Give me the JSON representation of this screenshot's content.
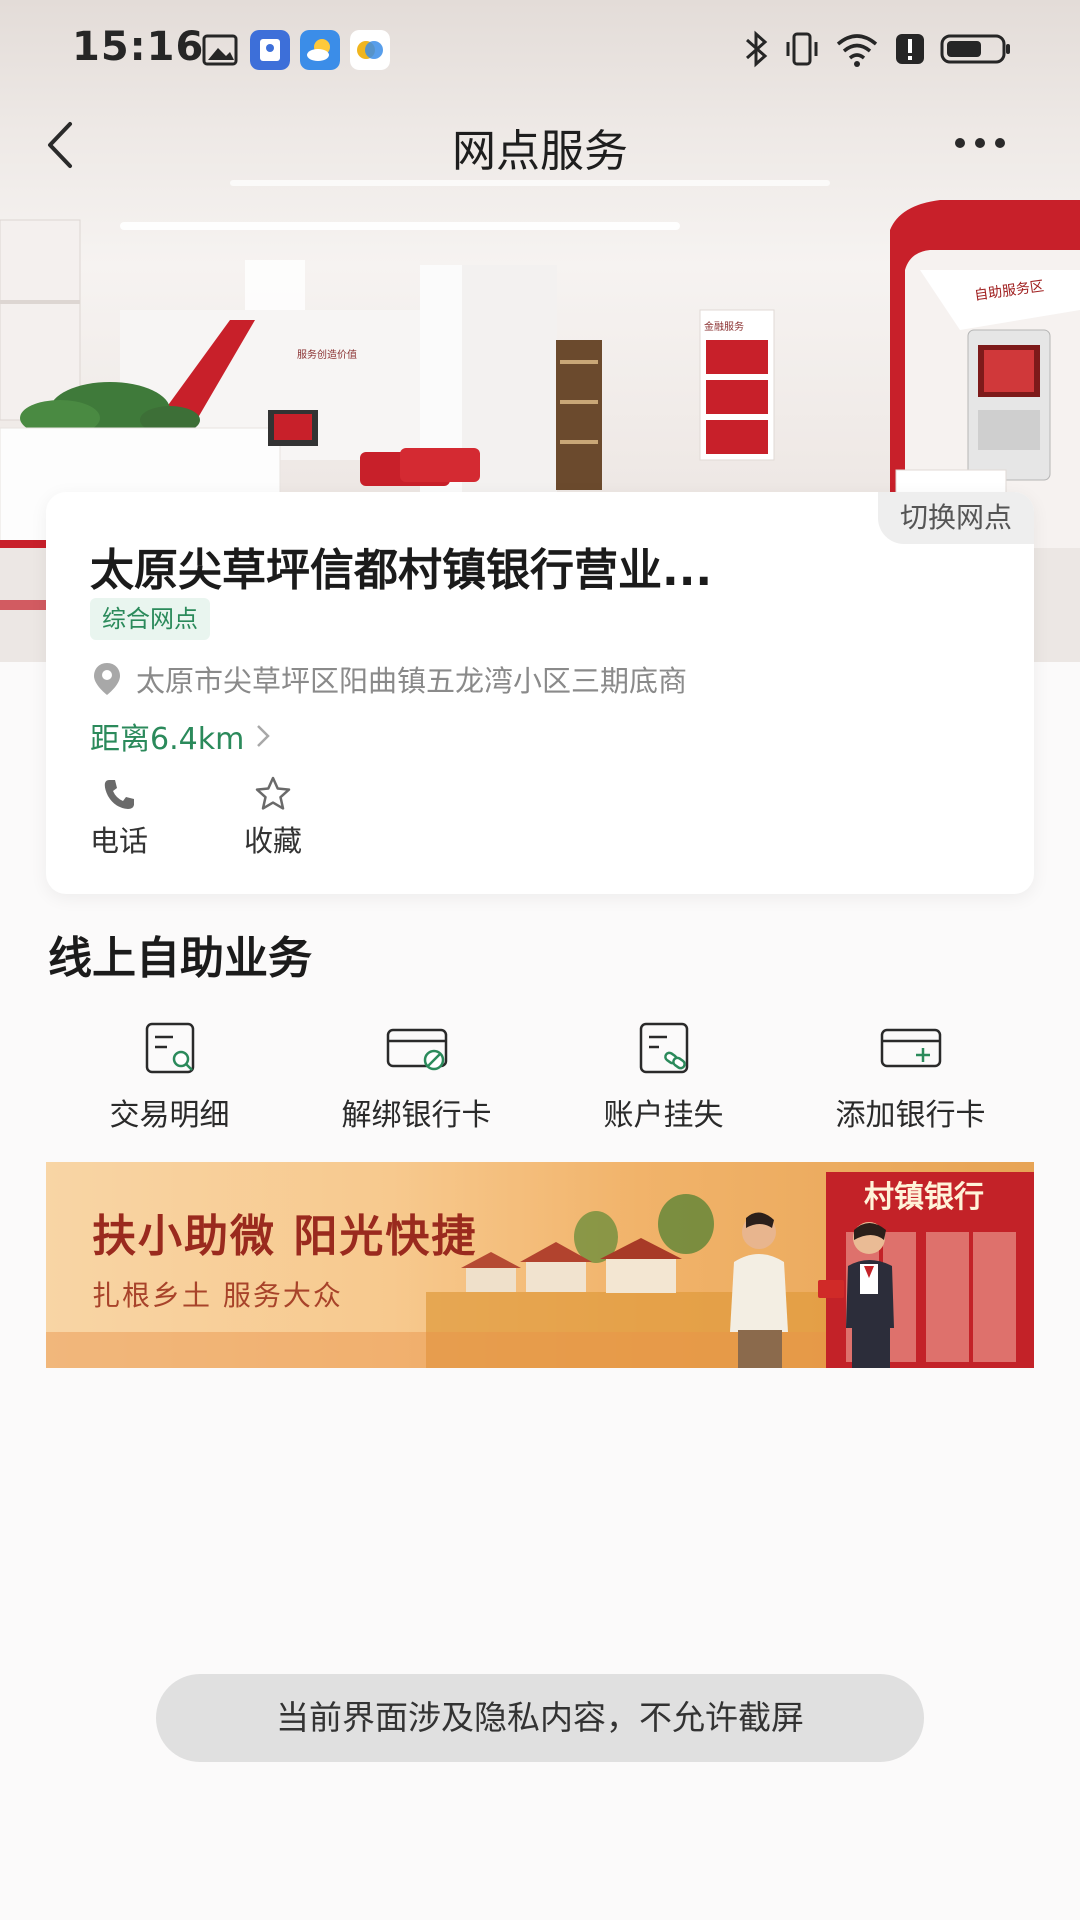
{
  "status_bar": {
    "time": "15:16"
  },
  "nav": {
    "title": "网点服务"
  },
  "branch": {
    "switch_label": "切换网点",
    "name": "太原尖草坪信都村镇银行营业...",
    "tag": "综合网点",
    "address": "太原市尖草坪区阳曲镇五龙湾小区三期底商",
    "distance": "距离6.4km",
    "actions": [
      {
        "label": "电话",
        "icon": "phone-icon"
      },
      {
        "label": "收藏",
        "icon": "star-icon"
      }
    ]
  },
  "online_services": {
    "title": "线上自助业务",
    "items": [
      {
        "label": "交易明细",
        "icon": "transaction-detail-icon"
      },
      {
        "label": "解绑银行卡",
        "icon": "unbind-card-icon"
      },
      {
        "label": "账户挂失",
        "icon": "report-loss-icon"
      },
      {
        "label": "添加银行卡",
        "icon": "add-card-icon"
      }
    ]
  },
  "banner": {
    "headline": "扶小助微 阳光快捷",
    "subline": "扎根乡土 服务大众",
    "sign": "村镇银行"
  },
  "hero": {
    "wall_sign": "服务创造价值",
    "cabinet_sign": "金融服务",
    "atm_sign": "自助服务区"
  },
  "toast": {
    "message": "当前界面涉及隐私内容，不允许截屏"
  },
  "colors": {
    "accent_green": "#2b8a5b",
    "brand_red": "#c8202a"
  }
}
